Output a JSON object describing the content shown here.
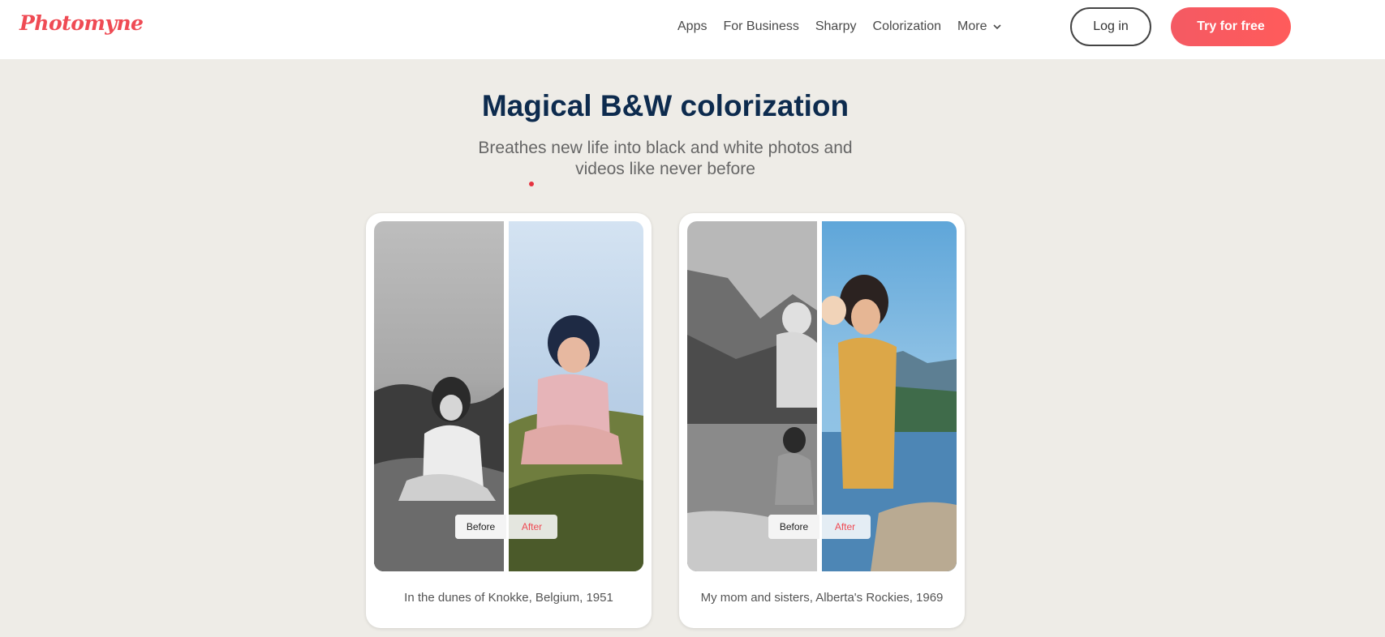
{
  "brand": {
    "logo": "Photomyne",
    "accent": "#ef4b54",
    "navy": "#0d2b4e"
  },
  "nav": {
    "items": [
      "Apps",
      "For Business",
      "Sharpy",
      "Colorization",
      "More"
    ],
    "more_icon": "chevron-down-icon",
    "login_label": "Log in",
    "cta_label": "Try for free"
  },
  "hero": {
    "title": "Magical B&W colorization",
    "subtitle": "Breathes new life into black and white photos and videos like never before"
  },
  "cards": [
    {
      "caption": "In the dunes of Knokke, Belgium, 1951",
      "before_label": "Before",
      "after_label": "After"
    },
    {
      "caption": "My mom and sisters, Alberta's Rockies, 1969",
      "before_label": "Before",
      "after_label": "After"
    }
  ]
}
